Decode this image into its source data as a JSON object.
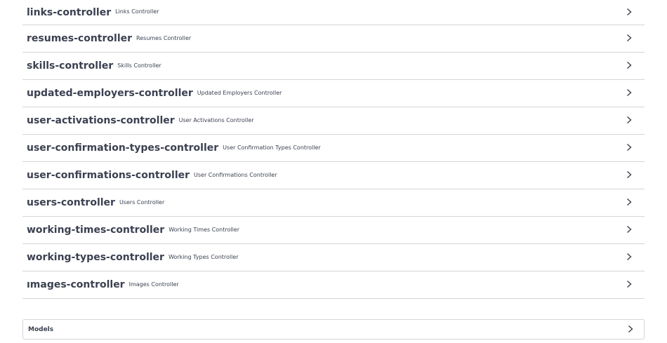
{
  "tags": [
    {
      "name": "links-controller",
      "description": "Links Controller"
    },
    {
      "name": "resumes-controller",
      "description": "Resumes Controller"
    },
    {
      "name": "skills-controller",
      "description": "Skills Controller"
    },
    {
      "name": "updated-employers-controller",
      "description": "Updated Employers Controller"
    },
    {
      "name": "user-activations-controller",
      "description": "User Activations Controller"
    },
    {
      "name": "user-confirmation-types-controller",
      "description": "User Confirmation Types Controller"
    },
    {
      "name": "user-confirmations-controller",
      "description": "User Confirmations Controller"
    },
    {
      "name": "users-controller",
      "description": "Users Controller"
    },
    {
      "name": "working-times-controller",
      "description": "Working Times Controller"
    },
    {
      "name": "working-types-controller",
      "description": "Working Types Controller"
    },
    {
      "name": "ımages-controller",
      "description": "Images Controller"
    }
  ],
  "models": {
    "label": "Models"
  },
  "icons": {
    "expand": "chevron-right-icon"
  },
  "colors": {
    "text": "#3b4151",
    "border": "#d5d5d8"
  }
}
